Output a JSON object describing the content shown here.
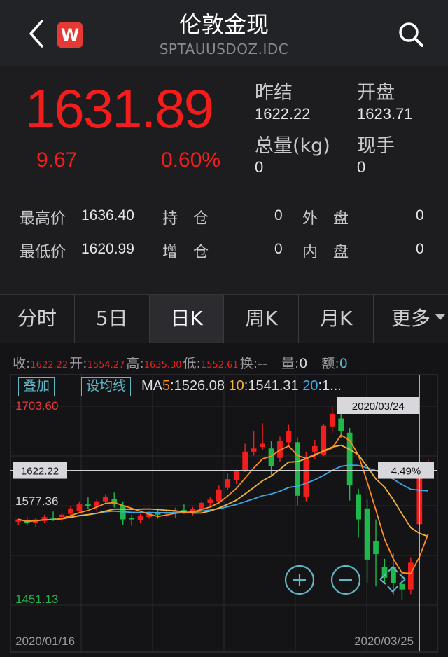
{
  "header": {
    "title": "伦敦金现",
    "subtitle": "SPTAUUSDOZ.IDC",
    "logo_letter": "W",
    "back_icon": "chevron-left-icon",
    "search_icon": "search-icon"
  },
  "quote": {
    "price": "1631.89",
    "change": "9.67",
    "change_pct": "0.60%",
    "prev_settle_label": "昨结",
    "prev_settle_value": "1622.22",
    "open_label": "开盘",
    "open_value": "1623.71",
    "volume_label": "总量(kg)",
    "volume_value": "0",
    "current_hand_label": "现手",
    "current_hand_value": "0",
    "high_label": "最高价",
    "high_value": "1636.40",
    "low_label": "最低价",
    "low_value": "1620.99",
    "hold_label": "持　仓",
    "hold_value": "0",
    "add_label": "增　仓",
    "add_value": "0",
    "outer_label": "外　盘",
    "outer_value": "0",
    "inner_label": "内　盘",
    "inner_value": "0",
    "up_color": "#f21d1d"
  },
  "tabs": [
    {
      "label": "分时"
    },
    {
      "label": "5日"
    },
    {
      "label": "日K",
      "active": true
    },
    {
      "label": "周K"
    },
    {
      "label": "月K"
    },
    {
      "label": "更多"
    }
  ],
  "info_row": {
    "close_label": "收:",
    "close_value": "1622.22",
    "open_label": "开:",
    "open_value": "1554.27",
    "high_label": "高:",
    "high_value": "1635.30",
    "low_label": "低:",
    "low_value": "1552.61",
    "turnover_label": "换:",
    "turnover_value": "--",
    "volume_label": "量:",
    "volume_value": "0",
    "amount_label": "额:",
    "amount_value": "0"
  },
  "chart_controls": {
    "overlay_label": "叠加",
    "ma_setting_label": "设均线",
    "ma_prefix": "MA",
    "ma5_period": "5",
    "ma5_value": ":1526.08",
    "ma10_period": "10",
    "ma10_value": ":1541.31",
    "ma20_period": "20",
    "ma20_value": ":1...",
    "zoom_in_icon": "zoom-in-icon",
    "zoom_out_icon": "zoom-out-icon",
    "pan_icon": "drag-arrows-icon"
  },
  "chart_axis": {
    "y_top": "1703.60",
    "y_crosshair": "1622.22",
    "y_mid": "1577.36",
    "y_bottom": "1451.13",
    "x_start": "2020/01/16",
    "x_end": "2020/03/25",
    "crosshair_date": "2020/03/24",
    "crosshair_pct": "4.49%"
  },
  "chart_data": {
    "type": "candlestick",
    "x_start": "2020/01/16",
    "x_end": "2020/03/25",
    "ylim": [
      1451.13,
      1703.6
    ],
    "candles": [
      [
        1557,
        1561,
        1553,
        1560
      ],
      [
        1559,
        1563,
        1552,
        1555
      ],
      [
        1556,
        1562,
        1550,
        1560
      ],
      [
        1558,
        1566,
        1556,
        1563
      ],
      [
        1562,
        1570,
        1558,
        1561
      ],
      [
        1563,
        1568,
        1557,
        1566
      ],
      [
        1567,
        1577,
        1562,
        1574
      ],
      [
        1571,
        1583,
        1568,
        1579
      ],
      [
        1579,
        1588,
        1573,
        1577
      ],
      [
        1576,
        1586,
        1571,
        1583
      ],
      [
        1583,
        1592,
        1580,
        1589
      ],
      [
        1586,
        1594,
        1575,
        1579
      ],
      [
        1578,
        1583,
        1553,
        1560
      ],
      [
        1562,
        1566,
        1552,
        1560
      ],
      [
        1559,
        1567,
        1555,
        1564
      ],
      [
        1563,
        1570,
        1561,
        1569
      ],
      [
        1568,
        1574,
        1561,
        1566
      ],
      [
        1567,
        1573,
        1563,
        1569
      ],
      [
        1568,
        1575,
        1562,
        1571
      ],
      [
        1572,
        1579,
        1567,
        1569
      ],
      [
        1570,
        1576,
        1565,
        1573
      ],
      [
        1574,
        1583,
        1570,
        1581
      ],
      [
        1581,
        1588,
        1577,
        1585
      ],
      [
        1583,
        1603,
        1580,
        1598
      ],
      [
        1600,
        1618,
        1597,
        1611
      ],
      [
        1610,
        1623,
        1605,
        1621
      ],
      [
        1622,
        1656,
        1620,
        1646
      ],
      [
        1646,
        1672,
        1641,
        1650
      ],
      [
        1652,
        1682,
        1648,
        1656
      ],
      [
        1650,
        1660,
        1615,
        1628
      ],
      [
        1638,
        1665,
        1633,
        1660
      ],
      [
        1658,
        1680,
        1653,
        1672
      ],
      [
        1658,
        1664,
        1578,
        1590
      ],
      [
        1589,
        1646,
        1583,
        1637
      ],
      [
        1646,
        1661,
        1637,
        1653
      ],
      [
        1642,
        1681,
        1640,
        1679
      ],
      [
        1678,
        1703,
        1670,
        1694
      ],
      [
        1688,
        1694,
        1663,
        1672
      ],
      [
        1670,
        1676,
        1584,
        1603
      ],
      [
        1592,
        1599,
        1537,
        1560
      ],
      [
        1574,
        1585,
        1480,
        1509
      ],
      [
        1532,
        1560,
        1475,
        1516
      ],
      [
        1500,
        1510,
        1478,
        1486
      ],
      [
        1500,
        1517,
        1464,
        1479
      ],
      [
        1478,
        1492,
        1458,
        1471
      ],
      [
        1471,
        1512,
        1465,
        1505
      ],
      [
        1554,
        1635,
        1553,
        1622
      ],
      [
        1622,
        1636,
        1621,
        1632
      ]
    ]
  }
}
